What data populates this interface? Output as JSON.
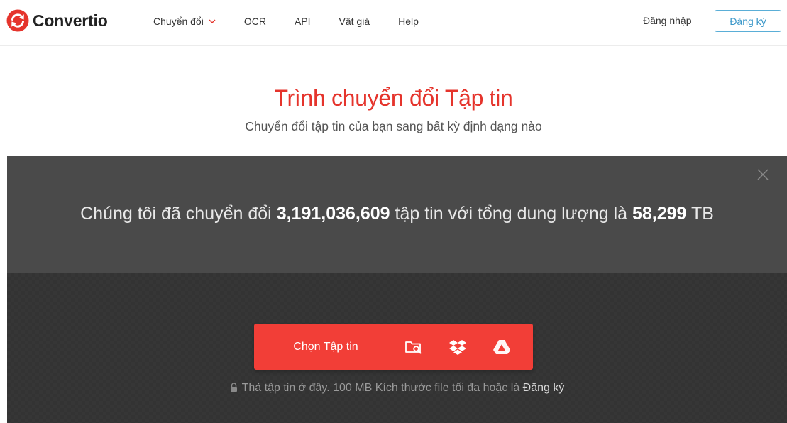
{
  "brand": {
    "name": "Convertio",
    "color": "#e5342c"
  },
  "nav": {
    "items": [
      {
        "label": "Chuyển đổi",
        "has_dropdown": true
      },
      {
        "label": "OCR"
      },
      {
        "label": "API"
      },
      {
        "label": "Vật giá"
      },
      {
        "label": "Help"
      }
    ],
    "login_label": "Đăng nhập",
    "signup_label": "Đăng ký"
  },
  "hero": {
    "title": "Trình chuyển đổi Tập tin",
    "subtitle": "Chuyển đổi tập tin của bạn sang bất kỳ định dạng nào"
  },
  "stats": {
    "prefix": "Chúng tôi đã chuyển đổi ",
    "files_count": "3,191,036,609",
    "middle": " tập tin với tổng dung lượng là ",
    "total_size": "58,299",
    "suffix": " TB"
  },
  "upload": {
    "choose_label": "Chọn Tập tin",
    "sources": [
      "folder-search-icon",
      "dropbox-icon",
      "google-drive-icon"
    ],
    "drop_note": "Thả tập tin ở đây. 100 MB Kích thước file tối đa hoặc là ",
    "drop_note_link": "Đăng ký",
    "button_color": "#f23e37"
  }
}
